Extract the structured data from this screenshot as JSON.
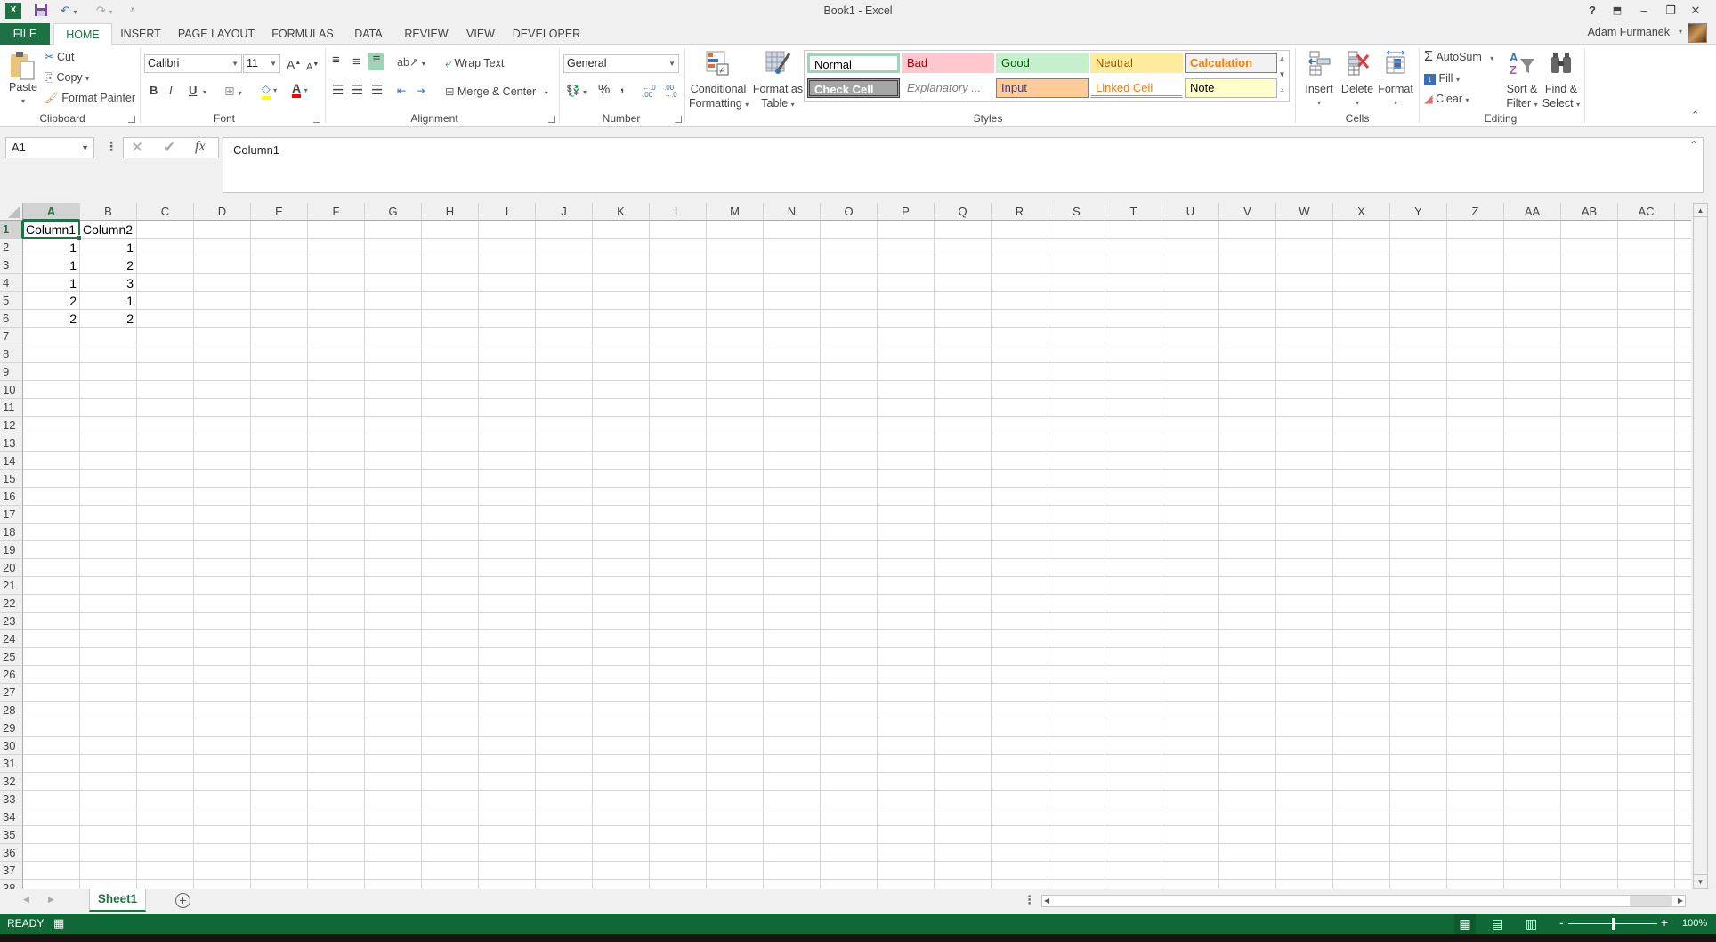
{
  "window": {
    "title": "Book1 - Excel",
    "user_name": "Adam Furmanek"
  },
  "colors": {
    "accent": "#217346",
    "file_tab": "#1e7145",
    "status_bar": "#116837"
  },
  "ribbon_tabs": [
    "FILE",
    "HOME",
    "INSERT",
    "PAGE LAYOUT",
    "FORMULAS",
    "DATA",
    "REVIEW",
    "VIEW",
    "DEVELOPER"
  ],
  "ribbon": {
    "clipboard": {
      "label": "Clipboard",
      "paste": "Paste",
      "cut": "Cut",
      "copy": "Copy",
      "format_painter": "Format Painter"
    },
    "font": {
      "label": "Font",
      "font_name": "Calibri",
      "font_size": "11",
      "bold": "B",
      "italic": "I",
      "underline": "U"
    },
    "alignment": {
      "label": "Alignment",
      "wrap_text": "Wrap Text",
      "merge_center": "Merge & Center"
    },
    "number": {
      "label": "Number",
      "format": "General",
      "percent": "%",
      "comma": ","
    },
    "styles": {
      "label": "Styles",
      "conditional_formatting": [
        "Conditional",
        "Formatting"
      ],
      "format_as_table": [
        "Format as",
        "Table"
      ],
      "cell_styles": [
        {
          "name": "Normal",
          "bg": "#ffffff",
          "fg": "#000000",
          "border": "#9fd5b7"
        },
        {
          "name": "Bad",
          "bg": "#ffc7ce",
          "fg": "#9c0006",
          "border": "#ffc7ce"
        },
        {
          "name": "Good",
          "bg": "#c6efce",
          "fg": "#006100",
          "border": "#c6efce"
        },
        {
          "name": "Neutral",
          "bg": "#ffeb9c",
          "fg": "#9c5700",
          "border": "#ffeb9c"
        },
        {
          "name": "Calculation",
          "bg": "#f2f2f2",
          "fg": "#fa7d00",
          "border": "#7f7f7f"
        },
        {
          "name": "Check Cell",
          "bg": "#a5a5a5",
          "fg": "#ffffff",
          "border": "#3f3f3f"
        },
        {
          "name": "Explanatory ...",
          "bg": "#ffffff",
          "fg": "#7f7f7f",
          "border": "#ffffff"
        },
        {
          "name": "Input",
          "bg": "#ffcc99",
          "fg": "#3f3f76",
          "border": "#7f7f7f"
        },
        {
          "name": "Linked Cell",
          "bg": "#ffffff",
          "fg": "#fa7d00",
          "border": "#ffffff"
        },
        {
          "name": "Note",
          "bg": "#ffffcc",
          "fg": "#000000",
          "border": "#b2b2b2"
        }
      ]
    },
    "cells": {
      "label": "Cells",
      "insert": "Insert",
      "delete": "Delete",
      "format": "Format"
    },
    "editing": {
      "label": "Editing",
      "autosum": "AutoSum",
      "fill": "Fill",
      "clear": "Clear",
      "sort_filter": [
        "Sort &",
        "Filter"
      ],
      "find_select": [
        "Find &",
        "Select"
      ]
    }
  },
  "formula_bar": {
    "name_box": "A1",
    "formula": "Column1"
  },
  "sheet": {
    "columns": [
      "A",
      "B",
      "C",
      "D",
      "E",
      "F",
      "G",
      "H",
      "I",
      "J",
      "K",
      "L",
      "M",
      "N",
      "O",
      "P",
      "Q",
      "R",
      "S",
      "T",
      "U",
      "V",
      "W",
      "X",
      "Y",
      "Z",
      "AA",
      "AB",
      "AC"
    ],
    "selected_column": "A",
    "selected_row": 1,
    "visible_rows": 38,
    "cells": [
      [
        "Column1",
        "Column2"
      ],
      [
        "1",
        "1"
      ],
      [
        "1",
        "2"
      ],
      [
        "1",
        "3"
      ],
      [
        "2",
        "1"
      ],
      [
        "2",
        "2"
      ]
    ]
  },
  "sheet_tabs": [
    "Sheet1"
  ],
  "status_bar": {
    "mode": "READY",
    "zoom": "100%",
    "zoom_percent": 100
  }
}
